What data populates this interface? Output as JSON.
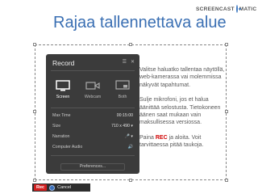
{
  "brand": {
    "left": "SCREENCAST",
    "right": "MATIC",
    "accent": "#3f79c2"
  },
  "page": {
    "title": "Rajaa tallennettava alue",
    "title_color": "#3a6fb3"
  },
  "record_panel": {
    "title": "Record",
    "modes": [
      {
        "label": "Screen",
        "icon": "monitor-icon",
        "selected": true
      },
      {
        "label": "Webcam",
        "icon": "webcam-icon",
        "selected": false
      },
      {
        "label": "Both",
        "icon": "monitor-webcam-icon",
        "selected": false
      }
    ],
    "rows": [
      {
        "label": "Max Time",
        "value": "00:15:00"
      },
      {
        "label": "Size",
        "value": "710 x 490"
      },
      {
        "label": "Narration",
        "value": ""
      },
      {
        "label": "Computer Audio",
        "value": ""
      }
    ],
    "preferences_label": "Preferences..."
  },
  "instructions": {
    "p1": "Valitse haluatko tallentaa näytöllä, web-kamerassa vai molemmissa näkyvät tapahtumat.",
    "p2": "Sulje mikrofoni, jos et halua äänittää selostusta. Tietokoneen äänen saat mukaan vain maksullisessa versiossa.",
    "p3_before": "Paina ",
    "p3_rec": "REC",
    "p3_after": " ja aloita. Voit tarvittaessa pitää taukoja."
  },
  "bottom_bar": {
    "rec_label": "Rec",
    "cancel_label": "Cancel"
  },
  "colors": {
    "rec_red": "#d22020",
    "panel_bg": "#3b3b3b"
  }
}
